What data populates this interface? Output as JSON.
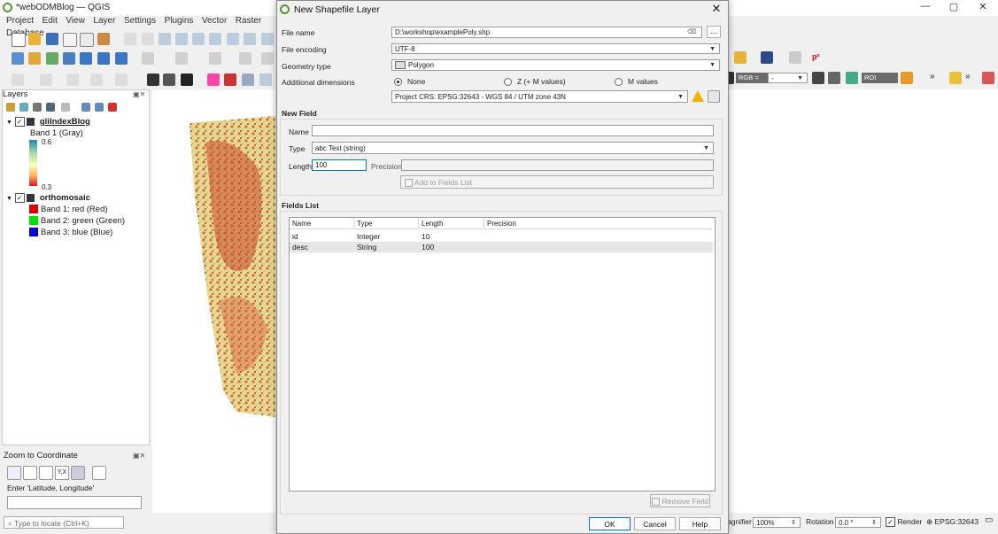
{
  "app": {
    "title": "*webODMBlog — QGIS",
    "menu": [
      "Project",
      "Edit",
      "View",
      "Layer",
      "Settings",
      "Plugins",
      "Vector",
      "Raster",
      "Database"
    ],
    "window_controls": [
      "—",
      "▢",
      "✕"
    ]
  },
  "layers_panel": {
    "title": "Layers",
    "layers": [
      {
        "name": "gliIndexBlog",
        "checked": true,
        "sub": "Band 1 (Gray)",
        "ramp_max": "0.6",
        "ramp_min": "0.3"
      },
      {
        "name": "orthomosaic",
        "checked": true,
        "bands": [
          {
            "label": "Band 1: red (Red)",
            "color": "#e00000"
          },
          {
            "label": "Band 2: green (Green)",
            "color": "#00e000"
          },
          {
            "label": "Band 3: blue (Blue)",
            "color": "#0000e0"
          }
        ]
      }
    ]
  },
  "zoom_panel": {
    "title": "Zoom to Coordinate",
    "prompt": "Enter 'Latitude, Longitude'",
    "xy_button": "Y,X"
  },
  "locator": {
    "placeholder": "Type to locate (Ctrl+K)"
  },
  "toolbar_right": {
    "rgb_label": "RGB =",
    "rgb_value": "-",
    "roi_label": "ROI",
    "p2_label": "p²"
  },
  "status_bar": {
    "magnifier_label": "agnifier",
    "magnifier_value": "100%",
    "rotation_label": "Rotation",
    "rotation_value": "0.0 °",
    "render_label": "Render",
    "crs": "EPSG:32643"
  },
  "dialog": {
    "title": "New Shapefile Layer",
    "file_name_label": "File name",
    "file_name_value": "D:\\workshop\\examplePoly.shp",
    "browse_label": "...",
    "encoding_label": "File encoding",
    "encoding_value": "UTF-8",
    "geometry_label": "Geometry type",
    "geometry_value": "Polygon",
    "dimensions_label": "Additional dimensions",
    "dim_options": [
      "None",
      "Z (+ M values)",
      "M values"
    ],
    "dim_selected": "None",
    "crs_value": "Project CRS: EPSG:32643 - WGS 84 / UTM zone 43N",
    "new_field": {
      "title": "New Field",
      "name_label": "Name",
      "name_value": "",
      "type_label": "Type",
      "type_value": "abc Text (string)",
      "length_label": "Length",
      "length_value": "100",
      "precision_label": "Precision",
      "precision_value": "",
      "add_button": "Add to Fields List"
    },
    "fields_list": {
      "title": "Fields List",
      "columns": [
        "Name",
        "Type",
        "Length",
        "Precision"
      ],
      "rows": [
        {
          "name": "id",
          "type": "Integer",
          "length": "10",
          "precision": ""
        },
        {
          "name": "desc",
          "type": "String",
          "length": "100",
          "precision": ""
        }
      ],
      "remove_button": "Remove Field"
    },
    "buttons": {
      "ok": "OK",
      "cancel": "Cancel",
      "help": "Help"
    }
  }
}
